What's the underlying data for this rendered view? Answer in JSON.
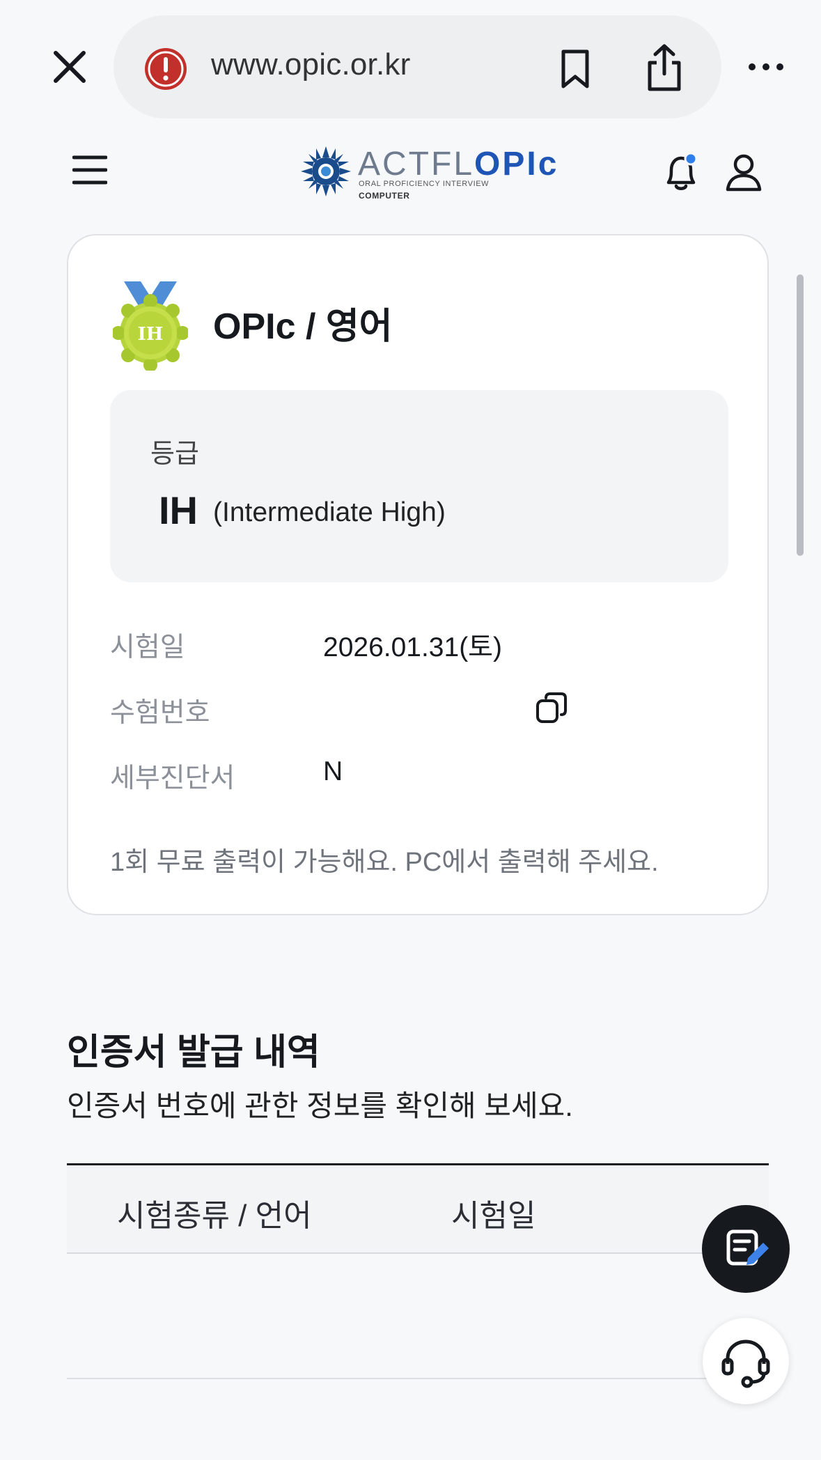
{
  "browser": {
    "url": "www.opic.or.kr",
    "icons": [
      "close-icon",
      "warning-icon",
      "bookmark-icon",
      "share-icon",
      "more-icon"
    ]
  },
  "header": {
    "logo_main": "ACTFL",
    "logo_accent": "OPIc",
    "logo_sub1": "ORAL PROFICIENCY INTERVIEW",
    "logo_sub2": "COMPUTER",
    "icons": [
      "menu-icon",
      "bell-icon",
      "user-icon"
    ],
    "accent_color": "#1f55b5",
    "notification_dot_color": "#2f7fe8"
  },
  "result_card": {
    "medal_text": "IH",
    "title": "OPIc / 영어",
    "grade_label": "등급",
    "grade_code": "IH",
    "grade_name": "(Intermediate High)",
    "rows": [
      {
        "label": "시험일",
        "value": "2026.01.31(토)"
      },
      {
        "label": "수험번호",
        "value": ""
      },
      {
        "label": "세부진단서",
        "value": "N"
      }
    ],
    "note": "1회 무료 출력이 가능해요. PC에서 출력해 주세요."
  },
  "certificates": {
    "title": "인증서 발급 내역",
    "subtitle": "인증서 번호에 관한 정보를 확인해 보세요.",
    "columns": [
      "시험종류 / 언어",
      "시험일"
    ]
  },
  "floating": {
    "icons": [
      "note-edit-icon",
      "headset-icon"
    ]
  }
}
